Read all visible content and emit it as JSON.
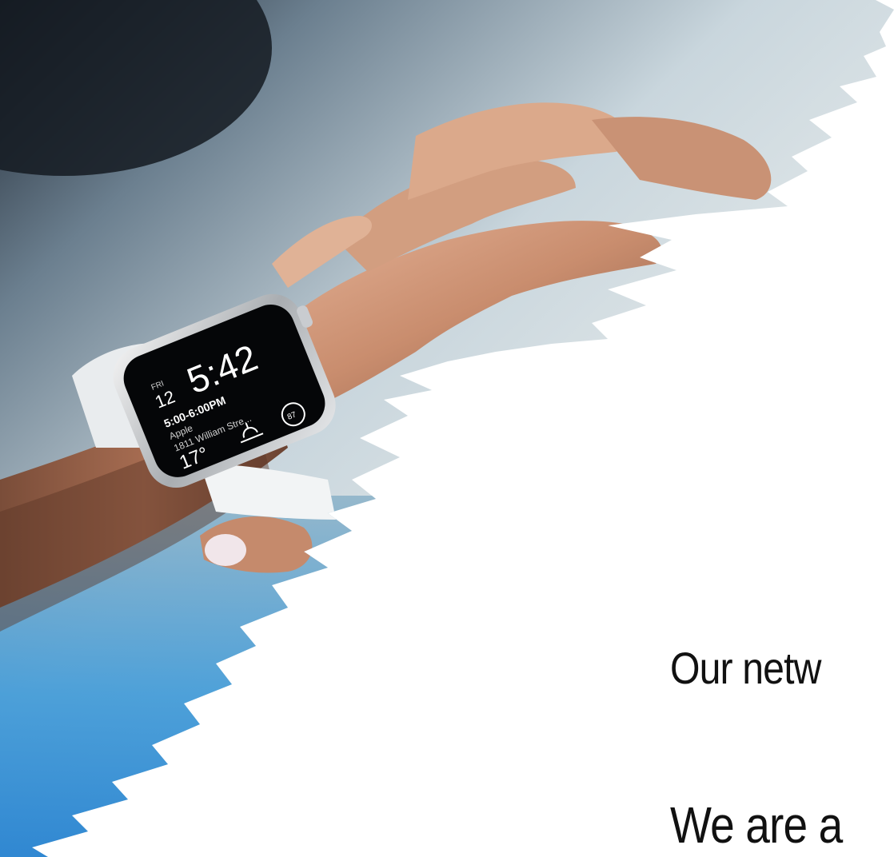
{
  "slide": {
    "headline": "Our netw",
    "subline": "We are a"
  },
  "watch_face": {
    "day_abbr": "FRI",
    "day_number": "12",
    "time": "5:42",
    "event_time": "5:00-6:00PM",
    "event_name": "Apple",
    "event_address": "1811 William Stre...",
    "temperature": "17°",
    "activity_value": "87"
  },
  "icons": {
    "watch": "smartwatch-icon",
    "sunrise": "sunrise-icon"
  },
  "colors": {
    "background": "#ffffff",
    "text": "#111111",
    "photo_blue": "#2e8fd6",
    "skin": "#c98d6e"
  }
}
